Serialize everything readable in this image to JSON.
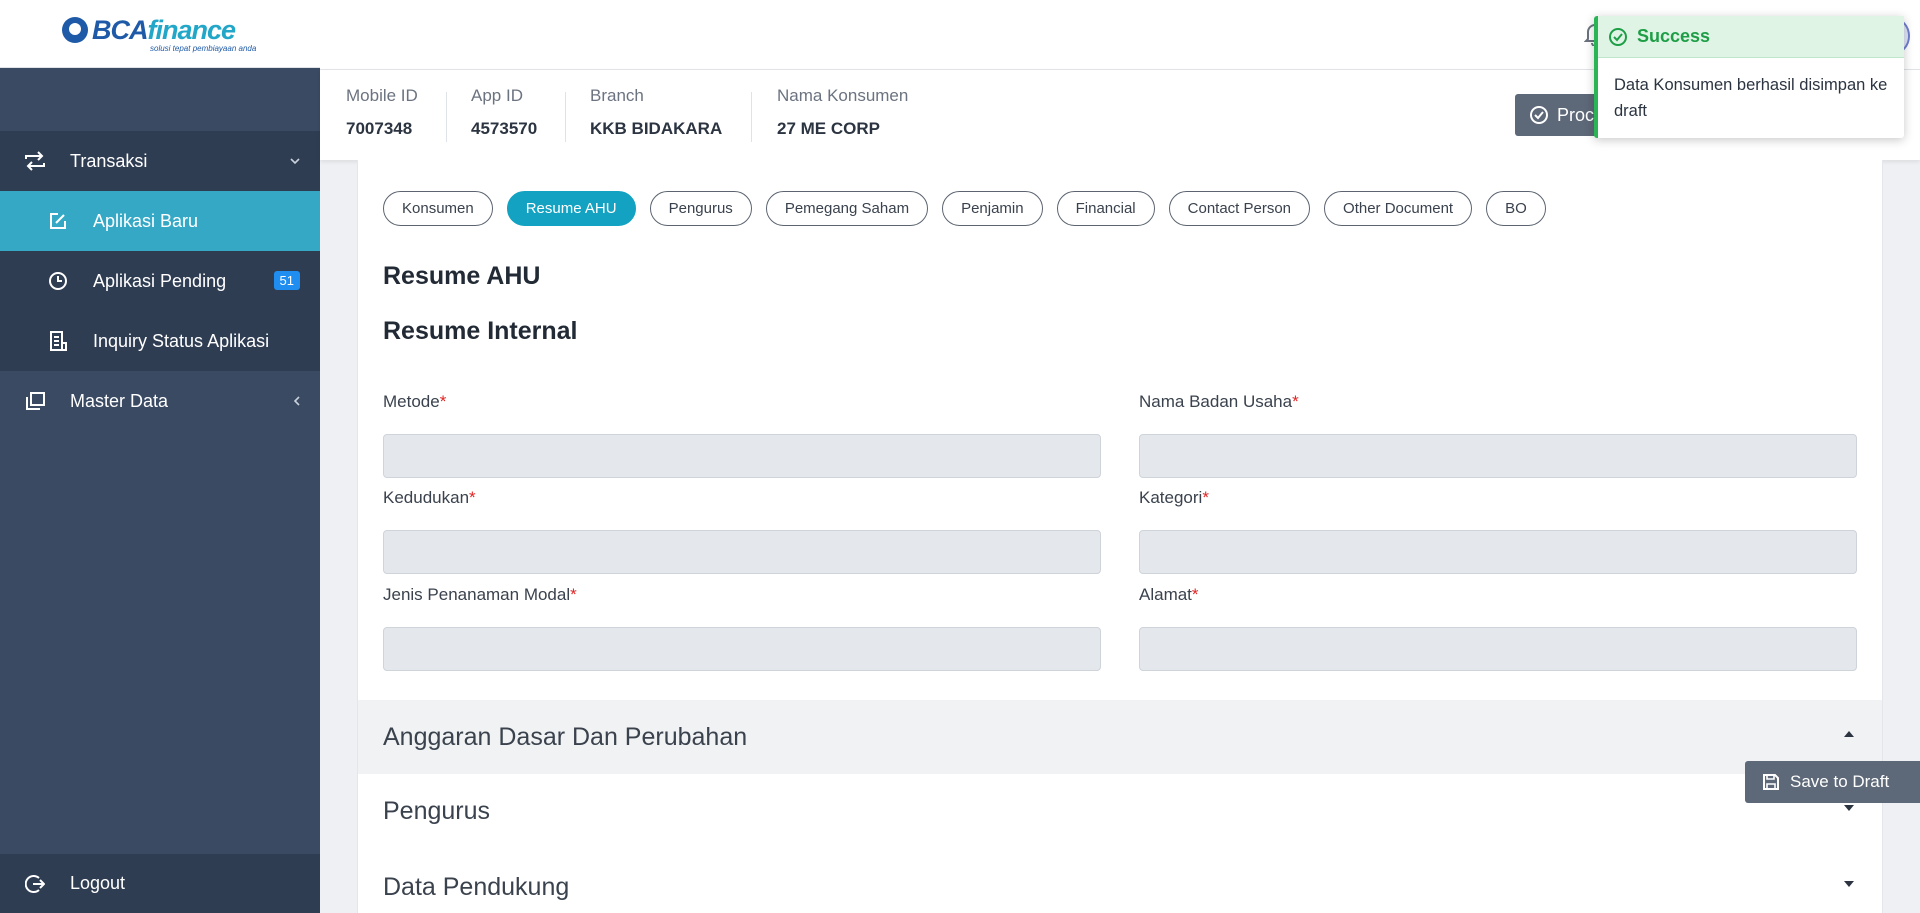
{
  "brand": {
    "name_part1": "BCA",
    "name_part2": "finance",
    "tagline": "solusi tepat pembiayaan anda"
  },
  "sidebar": {
    "groups": [
      {
        "label": "Transaksi",
        "icon": "swap-arrows-icon",
        "expanded": true
      },
      {
        "label": "Master Data",
        "icon": "copy-icon",
        "expanded": false
      }
    ],
    "items": [
      {
        "label": "Aplikasi Baru",
        "icon": "edit-icon",
        "active": true
      },
      {
        "label": "Aplikasi Pending",
        "icon": "clock-icon",
        "badge": "51"
      },
      {
        "label": "Inquiry Status Aplikasi",
        "icon": "document-list-icon"
      }
    ],
    "logout_label": "Logout"
  },
  "info": {
    "mobile_id_label": "Mobile ID",
    "mobile_id_value": "7007348",
    "app_id_label": "App ID",
    "app_id_value": "4573570",
    "branch_label": "Branch",
    "branch_value": "KKB BIDAKARA",
    "nama_label": "Nama Konsumen",
    "nama_value": "27 ME CORP",
    "proceed_label": "Proceed"
  },
  "tabs": [
    {
      "label": "Konsumen"
    },
    {
      "label": "Resume AHU",
      "active": true
    },
    {
      "label": "Pengurus"
    },
    {
      "label": "Pemegang Saham"
    },
    {
      "label": "Penjamin"
    },
    {
      "label": "Financial"
    },
    {
      "label": "Contact Person"
    },
    {
      "label": "Other Document"
    },
    {
      "label": "BO"
    }
  ],
  "main": {
    "title": "Resume AHU",
    "subtitle": "Resume Internal",
    "fields": {
      "metode": {
        "label": "Metode",
        "value": ""
      },
      "nama_badan_usaha": {
        "label": "Nama Badan Usaha",
        "value": ""
      },
      "kedudukan": {
        "label": "Kedudukan",
        "value": ""
      },
      "kategori": {
        "label": "Kategori",
        "value": ""
      },
      "jenis_penanaman_modal": {
        "label": "Jenis Penanaman Modal",
        "value": ""
      },
      "alamat": {
        "label": "Alamat",
        "value": ""
      }
    },
    "required_mark": "*",
    "accordions": [
      {
        "label": "Anggaran Dasar Dan Perubahan",
        "expanded": true
      },
      {
        "label": "Pengurus",
        "expanded": false
      },
      {
        "label": "Data Pendukung",
        "expanded": false
      }
    ]
  },
  "save_draft_label": "Save to Draft",
  "toast": {
    "title": "Success",
    "message": "Data Konsumen berhasil disimpan ke draft",
    "color": "#2bb455"
  },
  "colors": {
    "sidebar": "#3a4a63",
    "active": "#35a8c6",
    "tab_active": "#13a2c2",
    "badge": "#1f8ef0"
  }
}
